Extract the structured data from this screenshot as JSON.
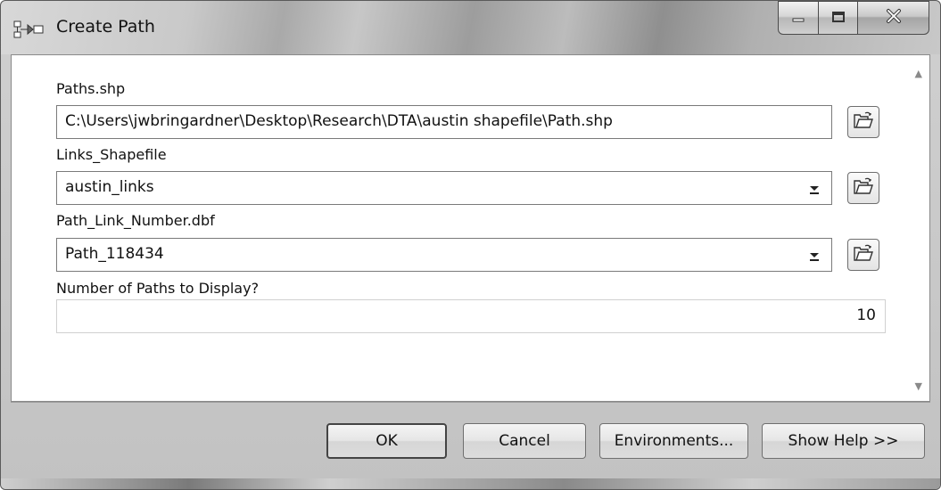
{
  "window": {
    "title": "Create Path",
    "icons": {
      "app": "model-tool-icon",
      "minimize": "minimize-icon",
      "maximize": "maximize-icon",
      "close": "close-icon"
    }
  },
  "form": {
    "fields": [
      {
        "label": "Paths.shp",
        "value": "C:\\Users\\jwbringardner\\Desktop\\Research\\DTA\\austin shapefile\\Path.shp",
        "type": "text",
        "browse_icon": "open-folder-icon"
      },
      {
        "label": "Links_Shapefile",
        "value": "austin_links",
        "type": "dropdown",
        "browse_icon": "open-folder-icon"
      },
      {
        "label": "Path_Link_Number.dbf",
        "value": "Path_118434",
        "type": "dropdown",
        "browse_icon": "open-folder-icon"
      },
      {
        "label": "Number of Paths to Display?",
        "value": "10",
        "type": "number"
      }
    ]
  },
  "scrollbar": {
    "up_icon": "scroll-up-arrow-icon",
    "down_icon": "scroll-down-arrow-icon"
  },
  "buttons": {
    "ok": "OK",
    "cancel": "Cancel",
    "environments": "Environments...",
    "show_help": "Show Help >>"
  },
  "colors": {
    "frame": "#c2c2c2",
    "client_background": "#ffffff",
    "border": "#7a7a7a"
  }
}
